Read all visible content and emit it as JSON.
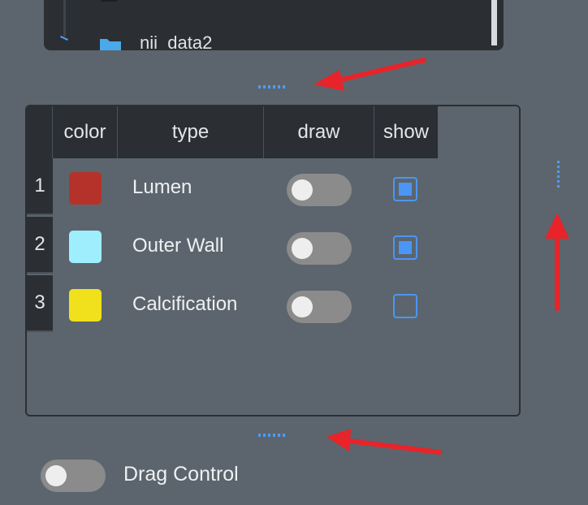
{
  "tree": {
    "node_label": "nii_data2"
  },
  "table": {
    "headers": {
      "color": "color",
      "type": "type",
      "draw": "draw",
      "show": "show"
    },
    "rows": [
      {
        "index": "1",
        "type": "Lumen",
        "color": "#b5322a",
        "draw_on": false,
        "show_checked": true
      },
      {
        "index": "2",
        "type": "Outer Wall",
        "color": "#9eeefe",
        "draw_on": false,
        "show_checked": true
      },
      {
        "index": "3",
        "type": "Calcification",
        "color": "#f0e11c",
        "draw_on": false,
        "show_checked": false
      }
    ]
  },
  "drag_control": {
    "label": "Drag Control",
    "on": false
  },
  "colors": {
    "background": "#5c656d",
    "panel_dark": "#2b2f33",
    "accent_blue": "#4a96f5",
    "annotation_red": "#e8232a"
  },
  "icons": [
    "folder-icon",
    "splitter-handle-icon",
    "annotation-arrow-icon"
  ]
}
